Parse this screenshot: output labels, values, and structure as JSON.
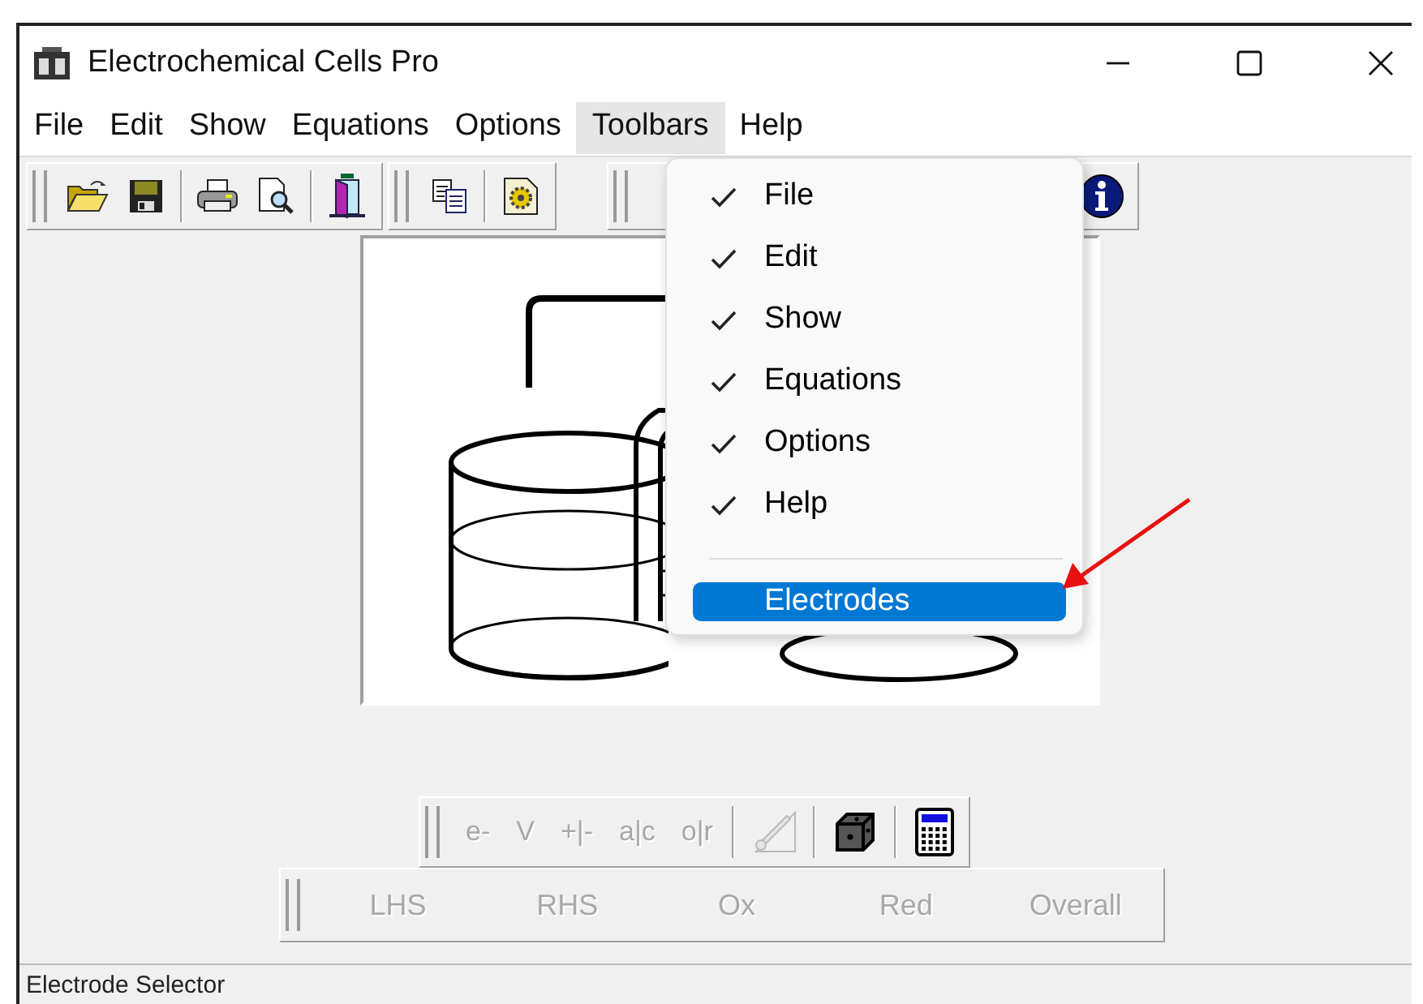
{
  "window": {
    "title": "Electrochemical Cells Pro"
  },
  "menu_bar": [
    {
      "label": "File",
      "selected": false
    },
    {
      "label": "Edit",
      "selected": false
    },
    {
      "label": "Show",
      "selected": false
    },
    {
      "label": "Equations",
      "selected": false
    },
    {
      "label": "Options",
      "selected": false
    },
    {
      "label": "Toolbars",
      "selected": true
    },
    {
      "label": "Help",
      "selected": false
    }
  ],
  "toolbars_menu": {
    "items": [
      {
        "kind": "check",
        "label": "File",
        "checked": true,
        "selected": false
      },
      {
        "kind": "check",
        "label": "Edit",
        "checked": true,
        "selected": false
      },
      {
        "kind": "check",
        "label": "Show",
        "checked": true,
        "selected": false
      },
      {
        "kind": "check",
        "label": "Equations",
        "checked": true,
        "selected": false
      },
      {
        "kind": "check",
        "label": "Options",
        "checked": true,
        "selected": false
      },
      {
        "kind": "check",
        "label": "Help",
        "checked": true,
        "selected": false
      },
      {
        "kind": "separator"
      },
      {
        "kind": "check",
        "label": "Electrodes",
        "checked": false,
        "selected": true
      }
    ]
  },
  "equation_toolbar": {
    "text_buttons": [
      {
        "label": "e-",
        "disabled": true
      },
      {
        "label": "V",
        "disabled": true
      },
      {
        "label": "+|-",
        "disabled": true
      },
      {
        "label": "a|c",
        "disabled": true
      },
      {
        "label": "o|r",
        "disabled": true
      }
    ],
    "icon_buttons": [
      {
        "kind": "probe",
        "disabled": true
      },
      {
        "kind": "dice",
        "disabled": false
      },
      {
        "kind": "calculator",
        "disabled": false
      }
    ]
  },
  "half_cell_toolbar": {
    "buttons": [
      {
        "label": "LHS",
        "disabled": true
      },
      {
        "label": "RHS",
        "disabled": true
      },
      {
        "label": "Ox",
        "disabled": true
      },
      {
        "label": "Red",
        "disabled": true
      },
      {
        "label": "Overall",
        "disabled": true
      }
    ]
  },
  "status_bar": {
    "text": "Electrode Selector"
  }
}
